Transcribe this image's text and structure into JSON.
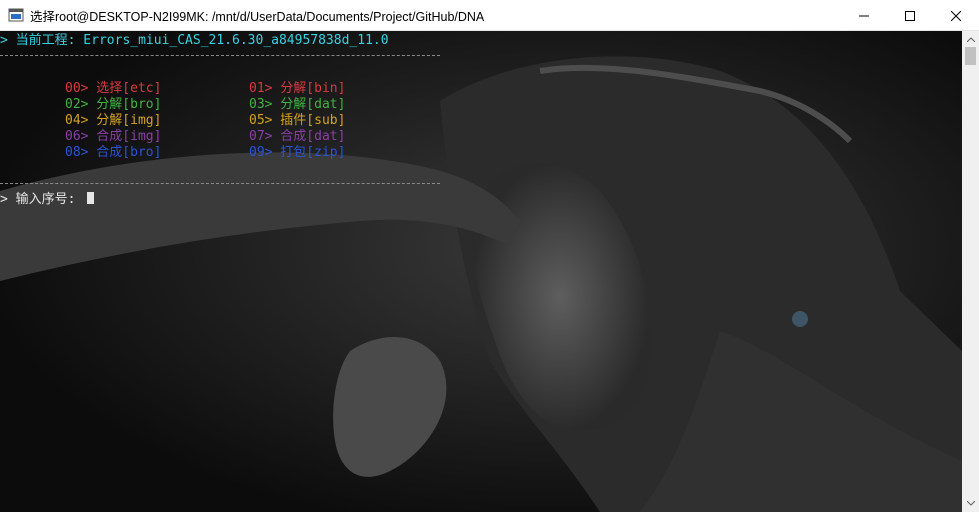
{
  "window": {
    "title": "选择root@DESKTOP-N2I99MK: /mnt/d/UserData/Documents/Project/GitHub/DNA"
  },
  "console": {
    "header_prompt": "> 当前工程: Errors_miui_CAS_21.6.30_a84957838d_11.0",
    "options": [
      {
        "label": "00> 选择[etc]",
        "color": "#d9393e"
      },
      {
        "label": "01> 分解[bin]",
        "color": "#d9393e"
      },
      {
        "label": "02> 分解[bro]",
        "color": "#3fb33f"
      },
      {
        "label": "03> 分解[dat]",
        "color": "#3fb33f"
      },
      {
        "label": "04> 分解[img]",
        "color": "#d4a21d"
      },
      {
        "label": "05> 插件[sub]",
        "color": "#d4a21d"
      },
      {
        "label": "06> 合成[img]",
        "color": "#8b3fa6"
      },
      {
        "label": "07> 合成[dat]",
        "color": "#8b3fa6"
      },
      {
        "label": "08> 合成[bro]",
        "color": "#2a55d8"
      },
      {
        "label": "09> 打包[zip]",
        "color": "#2a55d8"
      }
    ],
    "input_prompt": "> 输入序号: "
  },
  "colors": {
    "header": "#34d3e3",
    "prompt": "#e6e6e6",
    "separator": "#8a8a8a"
  }
}
